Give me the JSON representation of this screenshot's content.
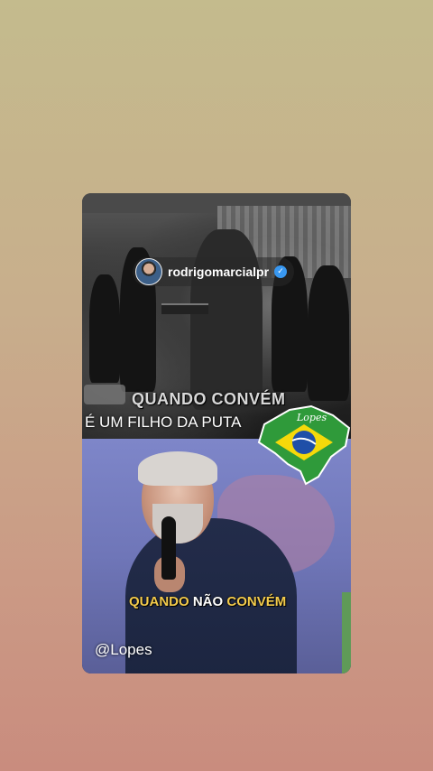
{
  "story": {
    "username": "rodrigomarcialpr",
    "verified_mark": "✓",
    "caption_top": "QUANDO CONVÉM",
    "caption_middle": "É UM FILHO DA PUTA",
    "caption_bottom": {
      "word_1": "QUANDO",
      "word_2": "NÃO",
      "word_3": "CONVÉM"
    },
    "watermark": "@Lopes",
    "badge_label": "Lopes"
  },
  "colors": {
    "caption_gold": "#f3cb4c",
    "verified_blue": "#3897f0",
    "brazil_green": "#2f9a3a",
    "brazil_yellow": "#f5d90a",
    "brazil_blue": "#1f4fa8"
  },
  "icons": {
    "avatar": "profile-avatar",
    "verified": "verified-badge-icon",
    "badge": "brazil-map-flag-icon"
  }
}
